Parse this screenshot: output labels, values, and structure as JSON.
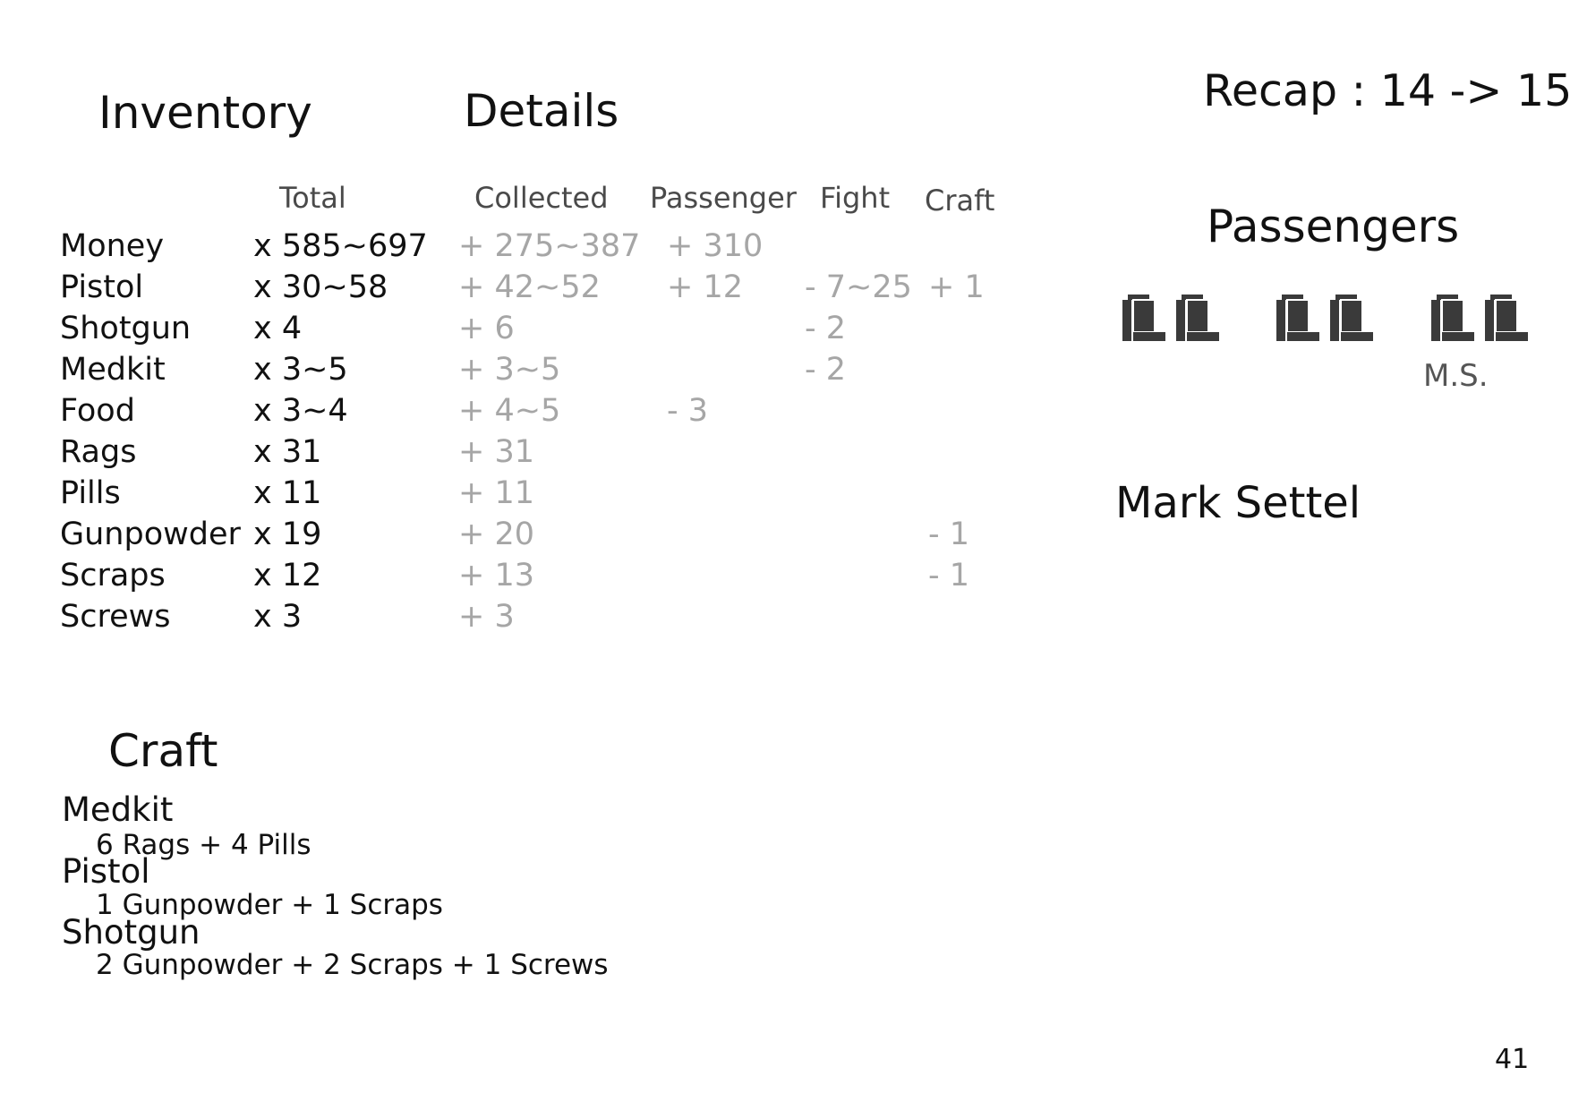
{
  "titles": {
    "inventory": "Inventory",
    "details": "Details",
    "craft": "Craft"
  },
  "columns": {
    "total": "Total",
    "collected": "Collected",
    "passenger": "Passenger",
    "fight": "Fight",
    "craft": "Craft"
  },
  "rows": [
    {
      "name": "Money",
      "total": "x 585~697",
      "collected": "+ 275~387",
      "passenger": "+ 310",
      "fight": "",
      "craft": ""
    },
    {
      "name": "Pistol",
      "total": "x 30~58",
      "collected": "+ 42~52",
      "passenger": "+ 12",
      "fight": "- 7~25",
      "craft": "+ 1"
    },
    {
      "name": "Shotgun",
      "total": "x 4",
      "collected": "+ 6",
      "passenger": "",
      "fight": "- 2",
      "craft": ""
    },
    {
      "name": "Medkit",
      "total": "x 3~5",
      "collected": "+ 3~5",
      "passenger": "",
      "fight": "- 2",
      "craft": ""
    },
    {
      "name": "Food",
      "total": "x 3~4",
      "collected": "+ 4~5",
      "passenger": "- 3",
      "fight": "",
      "craft": ""
    },
    {
      "name": "Rags",
      "total": "x 31",
      "collected": "+ 31",
      "passenger": "",
      "fight": "",
      "craft": ""
    },
    {
      "name": "Pills",
      "total": "x 11",
      "collected": "+ 11",
      "passenger": "",
      "fight": "",
      "craft": ""
    },
    {
      "name": "Gunpowder",
      "total": "x 19",
      "collected": "+ 20",
      "passenger": "",
      "fight": "",
      "craft": "- 1"
    },
    {
      "name": "Scraps",
      "total": "x 12",
      "collected": "+ 13",
      "passenger": "",
      "fight": "",
      "craft": "- 1"
    },
    {
      "name": "Screws",
      "total": "x 3",
      "collected": "+ 3",
      "passenger": "",
      "fight": "",
      "craft": ""
    }
  ],
  "recap": "Recap : 14 -> 15",
  "passengers": {
    "title": "Passengers",
    "seat_icon": "seat-icon",
    "seat_color": "#3a3a3a",
    "seat_count": 6,
    "seat_label": "M.S.",
    "selected_name": "Mark Settel"
  },
  "craft": [
    {
      "item": "Medkit",
      "recipe": "6 Rags + 4 Pills"
    },
    {
      "item": "Pistol",
      "recipe": "1 Gunpowder + 1 Scraps"
    },
    {
      "item": "Shotgun",
      "recipe": "2 Gunpowder + 2 Scraps + 1 Screws"
    }
  ],
  "page_number": "41"
}
